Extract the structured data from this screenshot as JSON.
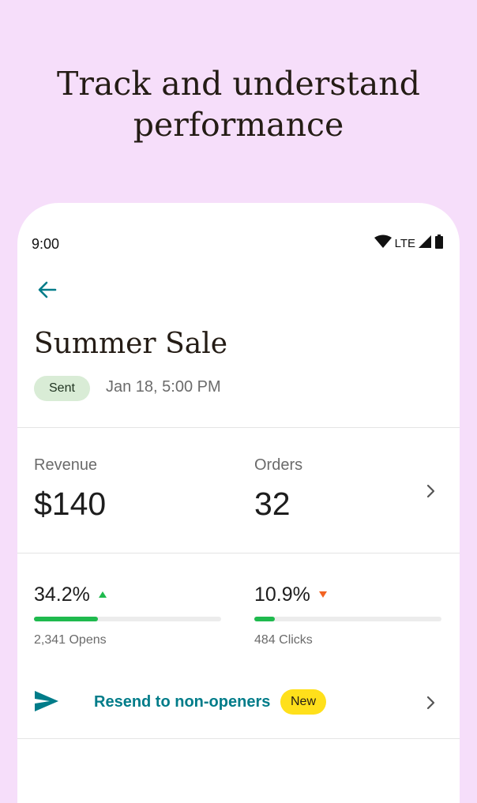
{
  "headline": {
    "line1": "Track and understand",
    "line2": "performance"
  },
  "status_bar": {
    "time": "9:00",
    "network": "LTE"
  },
  "campaign": {
    "title": "Summer Sale",
    "status": "Sent",
    "date": "Jan 18, 5:00 PM"
  },
  "metrics": {
    "revenue_label": "Revenue",
    "revenue_value": "$140",
    "orders_label": "Orders",
    "orders_value": "32"
  },
  "rates": {
    "open_rate": "34.2%",
    "open_trend": "up",
    "open_rate_fraction": 0.342,
    "opens_count": "2,341 Opens",
    "click_rate": "10.9%",
    "click_trend": "down",
    "click_rate_fraction": 0.109,
    "clicks_count": "484 Clicks"
  },
  "resend": {
    "label": "Resend to non-openers",
    "badge": "New"
  },
  "colors": {
    "background": "#f6defa",
    "accent_teal": "#007c89",
    "success_green": "#1fba4e",
    "trend_down": "#f26322",
    "badge_yellow": "#ffe01b",
    "sent_badge": "#d9ecd6"
  },
  "icons": {
    "back": "arrow-left-icon",
    "send": "send-icon",
    "chevron": "chevron-right-icon",
    "wifi": "wifi-icon",
    "signal": "signal-icon",
    "battery": "battery-icon"
  }
}
